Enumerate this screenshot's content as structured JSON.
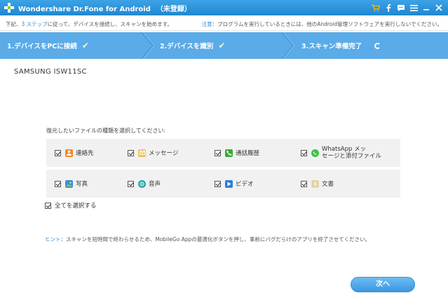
{
  "window": {
    "title": "Wondershare Dr.Fone for Android",
    "badge": "（未登録）"
  },
  "info": {
    "left_prefix": "下記、",
    "left_link": "3 ステップ",
    "left_suffix": "に従って、デバイスを接続し、スキャンを始めます。",
    "right_link": "注意",
    "right_text": "：プログラムを実行しているときには、他のAndroid管理ソフトウェアを実行しないでください。"
  },
  "steps": [
    {
      "label": "1.デバイスをPCに接続",
      "status": "done"
    },
    {
      "label": "2.デバイスを識別",
      "status": "done"
    },
    {
      "label": "3.スキャン準備完了",
      "status": "in-progress"
    }
  ],
  "device_name": "SAMSUNG ISW11SC",
  "prompt": "復元したいファイルの種類を選択してください:",
  "file_types": [
    {
      "label": "連絡先",
      "icon": "contacts-icon",
      "checked": true
    },
    {
      "label": "メッセージ",
      "icon": "messages-icon",
      "checked": true
    },
    {
      "label": "通話履歴",
      "icon": "call-log-icon",
      "checked": true
    },
    {
      "label_line1": "WhatsApp メッ",
      "label_line2": "セージと添付ファイル",
      "icon": "whatsapp-icon",
      "checked": true
    },
    {
      "label": "写真",
      "icon": "photos-icon",
      "checked": true
    },
    {
      "label": "音声",
      "icon": "audio-icon",
      "checked": true
    },
    {
      "label": "ビデオ",
      "icon": "video-icon",
      "checked": true
    },
    {
      "label": "文書",
      "icon": "documents-icon",
      "checked": true
    }
  ],
  "select_all": {
    "label": "全てを選択する",
    "checked": true
  },
  "hint": {
    "link": "ヒント",
    "text": "：スキャンを短時間で終わらせるため、MobileGo Appの最適化ボタンを押し、事前にバグだらけのアプリを終了させてください。"
  },
  "next_button": "次へ",
  "colors": {
    "titlebar": "#1f87d2",
    "stepbar": "#5aabe8",
    "accent": "#3b97e0"
  }
}
